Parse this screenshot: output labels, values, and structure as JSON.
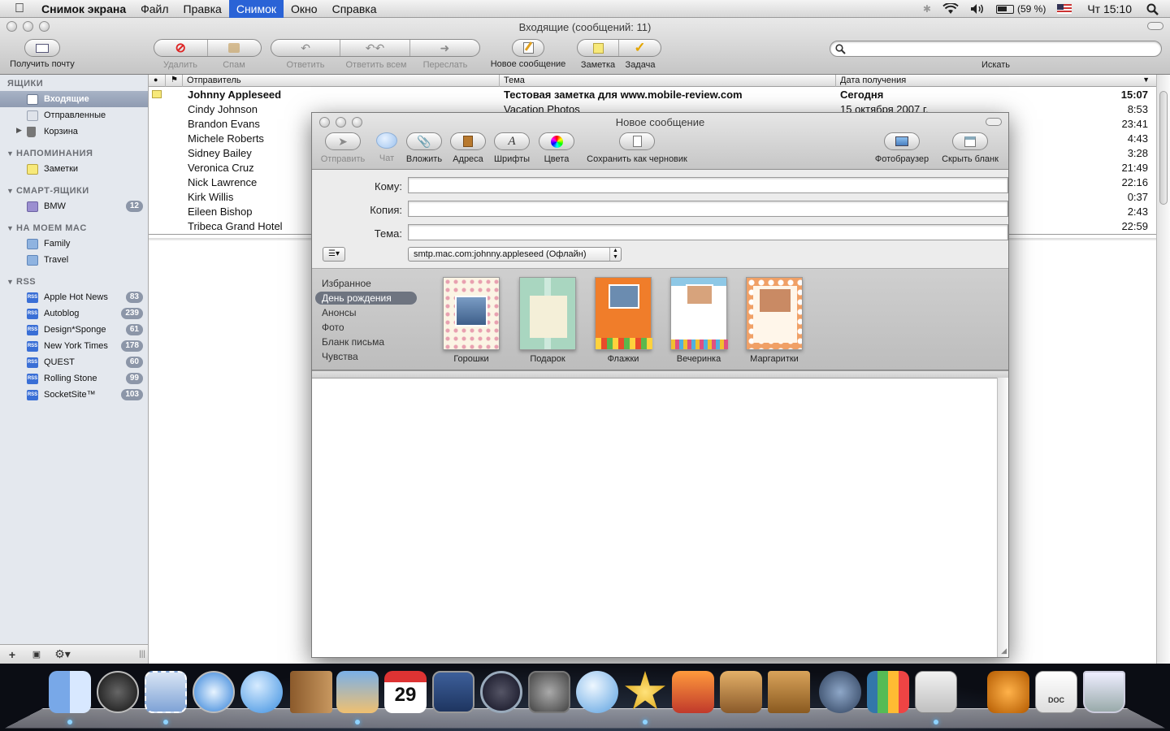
{
  "menubar": {
    "app": "Снимок экрана",
    "items": [
      "Файл",
      "Правка",
      "Снимок",
      "Окно",
      "Справка"
    ],
    "active": "Снимок",
    "battery": "(59 %)",
    "clock": "Чт 15:10"
  },
  "mail": {
    "title": "Входящие (сообщений: 11)",
    "toolbar": {
      "get_mail": "Получить почту",
      "delete": "Удалить",
      "junk": "Спам",
      "reply": "Ответить",
      "reply_all": "Ответить всем",
      "forward": "Переслать",
      "new_message": "Новое сообщение",
      "note": "Заметка",
      "todo": "Задача",
      "search_label": "Искать"
    },
    "sidebar": {
      "mailboxes_header": "ЯЩИКИ",
      "inbox": "Входящие",
      "sent": "Отправленные",
      "trash": "Корзина",
      "reminders_header": "НАПОМИНАНИЯ",
      "notes": "Заметки",
      "smart_header": "СМАРТ-ЯЩИКИ",
      "bmw": "BMW",
      "bmw_count": "12",
      "onmac_header": "НА МОЕМ MAC",
      "family": "Family",
      "travel": "Travel",
      "rss_header": "RSS",
      "rss_icon_text": "RSS",
      "rss": [
        {
          "name": "Apple Hot News",
          "count": "83"
        },
        {
          "name": "Autoblog",
          "count": "239"
        },
        {
          "name": "Design*Sponge",
          "count": "61"
        },
        {
          "name": "New York Times",
          "count": "178"
        },
        {
          "name": "QUEST",
          "count": "60"
        },
        {
          "name": "Rolling Stone",
          "count": "99"
        },
        {
          "name": "SocketSite™",
          "count": "103"
        }
      ]
    },
    "columns": {
      "sender": "Отправитель",
      "subject": "Тема",
      "date": "Дата получения"
    },
    "messages": [
      {
        "from": "Johnny Appleseed",
        "subject": "Тестовая заметка для www.mobile-review.com",
        "date": "Сегодня",
        "time": "15:07"
      },
      {
        "from": "Cindy Johnson",
        "subject": "Vacation Photos",
        "date": "15 октября 2007 г.",
        "time": "8:53"
      },
      {
        "from": "Brandon Evans",
        "subject": "",
        "date": "",
        "time": "23:41"
      },
      {
        "from": "Michele Roberts",
        "subject": "",
        "date": "",
        "time": "4:43"
      },
      {
        "from": "Sidney Bailey",
        "subject": "",
        "date": "",
        "time": "3:28"
      },
      {
        "from": "Veronica Cruz",
        "subject": "",
        "date": "",
        "time": "21:49"
      },
      {
        "from": "Nick Lawrence",
        "subject": "",
        "date": "",
        "time": "22:16"
      },
      {
        "from": "Kirk Willis",
        "subject": "",
        "date": "",
        "time": "0:37"
      },
      {
        "from": "Eileen Bishop",
        "subject": "",
        "date": "",
        "time": "2:43"
      },
      {
        "from": "Tribeca Grand Hotel",
        "subject": "",
        "date": "",
        "time": "22:59"
      }
    ]
  },
  "compose": {
    "title": "Новое сообщение",
    "toolbar": {
      "send": "Отправить",
      "chat": "Чат",
      "attach": "Вложить",
      "address": "Адреса",
      "fonts": "Шрифты",
      "colors": "Цвета",
      "save_draft": "Сохранить как черновик",
      "photo_browser": "Фотобраузер",
      "hide_stationery": "Скрыть бланк"
    },
    "fields": {
      "to": "Кому:",
      "cc": "Копия:",
      "subject": "Тема:"
    },
    "account": "smtp.mac.com:johnny.appleseed (Офлайн)",
    "stationery_categories": [
      "Избранное",
      "День рождения",
      "Анонсы",
      "Фото",
      "Бланк письма",
      "Чувства"
    ],
    "selected_category": "День рождения",
    "templates": [
      "Горошки",
      "Подарок",
      "Флажки",
      "Вечеринка",
      "Маргаритки"
    ]
  },
  "dock": {
    "apps": [
      "finder-icon",
      "dashboard-icon",
      "mail-icon",
      "safari-icon",
      "ichat-icon",
      "address-book-icon",
      "iphoto-icon",
      "ical-icon",
      "spaces-icon",
      "time-machine-icon",
      "system-preferences-icon",
      "itunes-icon",
      "imovie-icon",
      "photo-booth-icon",
      "iweb-icon",
      "keynote-icon",
      "pages-icon",
      "numbers-icon",
      "grab-icon",
      "garageband-icon",
      "document-icon",
      "trash-icon"
    ],
    "calendar_day": "29",
    "doc_label": "DOC"
  }
}
